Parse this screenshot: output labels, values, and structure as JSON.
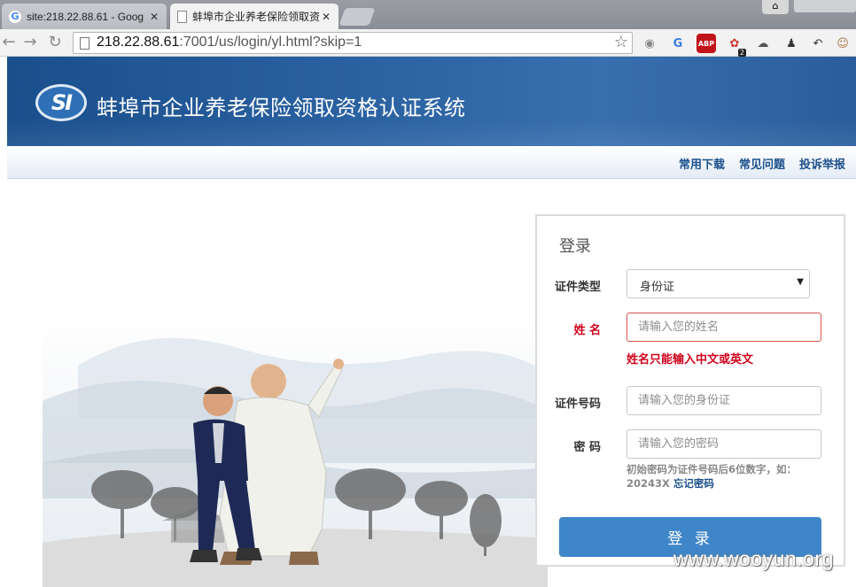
{
  "browser": {
    "tabs": [
      {
        "title": "site:218.22.88.61 - Goog",
        "active": false,
        "icon": "google-icon"
      },
      {
        "title": "蚌埠市企业养老保险领取资",
        "active": true,
        "icon": "page-icon"
      }
    ],
    "url_host": "218.22.88.61",
    "url_rest": ":7001/us/login/yl.html?skip=1",
    "extension_badge": "2"
  },
  "header": {
    "logo_text": "SI",
    "title": "蚌埠市企业养老保险领取资格认证系统"
  },
  "subnav": {
    "links": [
      "常用下载",
      "常见问题",
      "投诉举报"
    ]
  },
  "login": {
    "title": "登录",
    "id_type_label": "证件类型",
    "id_type_value": "身份证",
    "name_label": "姓 名",
    "name_placeholder": "请输入您的姓名",
    "name_error": "姓名只能输入中文或英文",
    "id_number_label": "证件号码",
    "id_number_placeholder": "请输入您的身份证",
    "password_label": "密 码",
    "password_placeholder": "请输入您的密码",
    "hint_text": "初始密码为证件号码后6位数字，如：20243X",
    "forgot_link": "忘记密码",
    "submit_label": "登 录"
  },
  "watermark": "www.wooyun.org",
  "colors": {
    "banner": "#2c63a3",
    "accent": "#3f86c9",
    "error": "#d0021b",
    "link": "#1b4f8a"
  }
}
